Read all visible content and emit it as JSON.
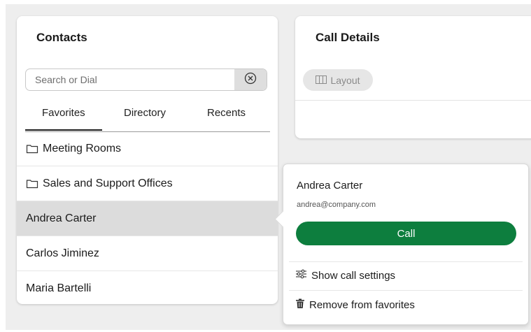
{
  "contacts": {
    "title": "Contacts",
    "search": {
      "placeholder": "Search or Dial",
      "value": ""
    },
    "tabs": [
      {
        "label": "Favorites",
        "active": true
      },
      {
        "label": "Directory",
        "active": false
      },
      {
        "label": "Recents",
        "active": false
      }
    ],
    "items": [
      {
        "label": "Meeting Rooms",
        "icon": "folder-icon"
      },
      {
        "label": "Sales and Support Offices",
        "icon": "folder-icon"
      },
      {
        "label": "Andrea Carter",
        "selected": true
      },
      {
        "label": "Carlos Jiminez"
      },
      {
        "label": "Maria Bartelli"
      }
    ]
  },
  "call_details": {
    "title": "Call Details",
    "layout_label": "Layout"
  },
  "popover": {
    "name": "Andrea Carter",
    "email": "andrea@company.com",
    "call_label": "Call",
    "show_settings_label": "Show call settings",
    "remove_label": "Remove from favorites"
  },
  "colors": {
    "accent_green": "#0d7e3e",
    "selected_row": "#dcdcdc",
    "background": "#eeeeee"
  }
}
